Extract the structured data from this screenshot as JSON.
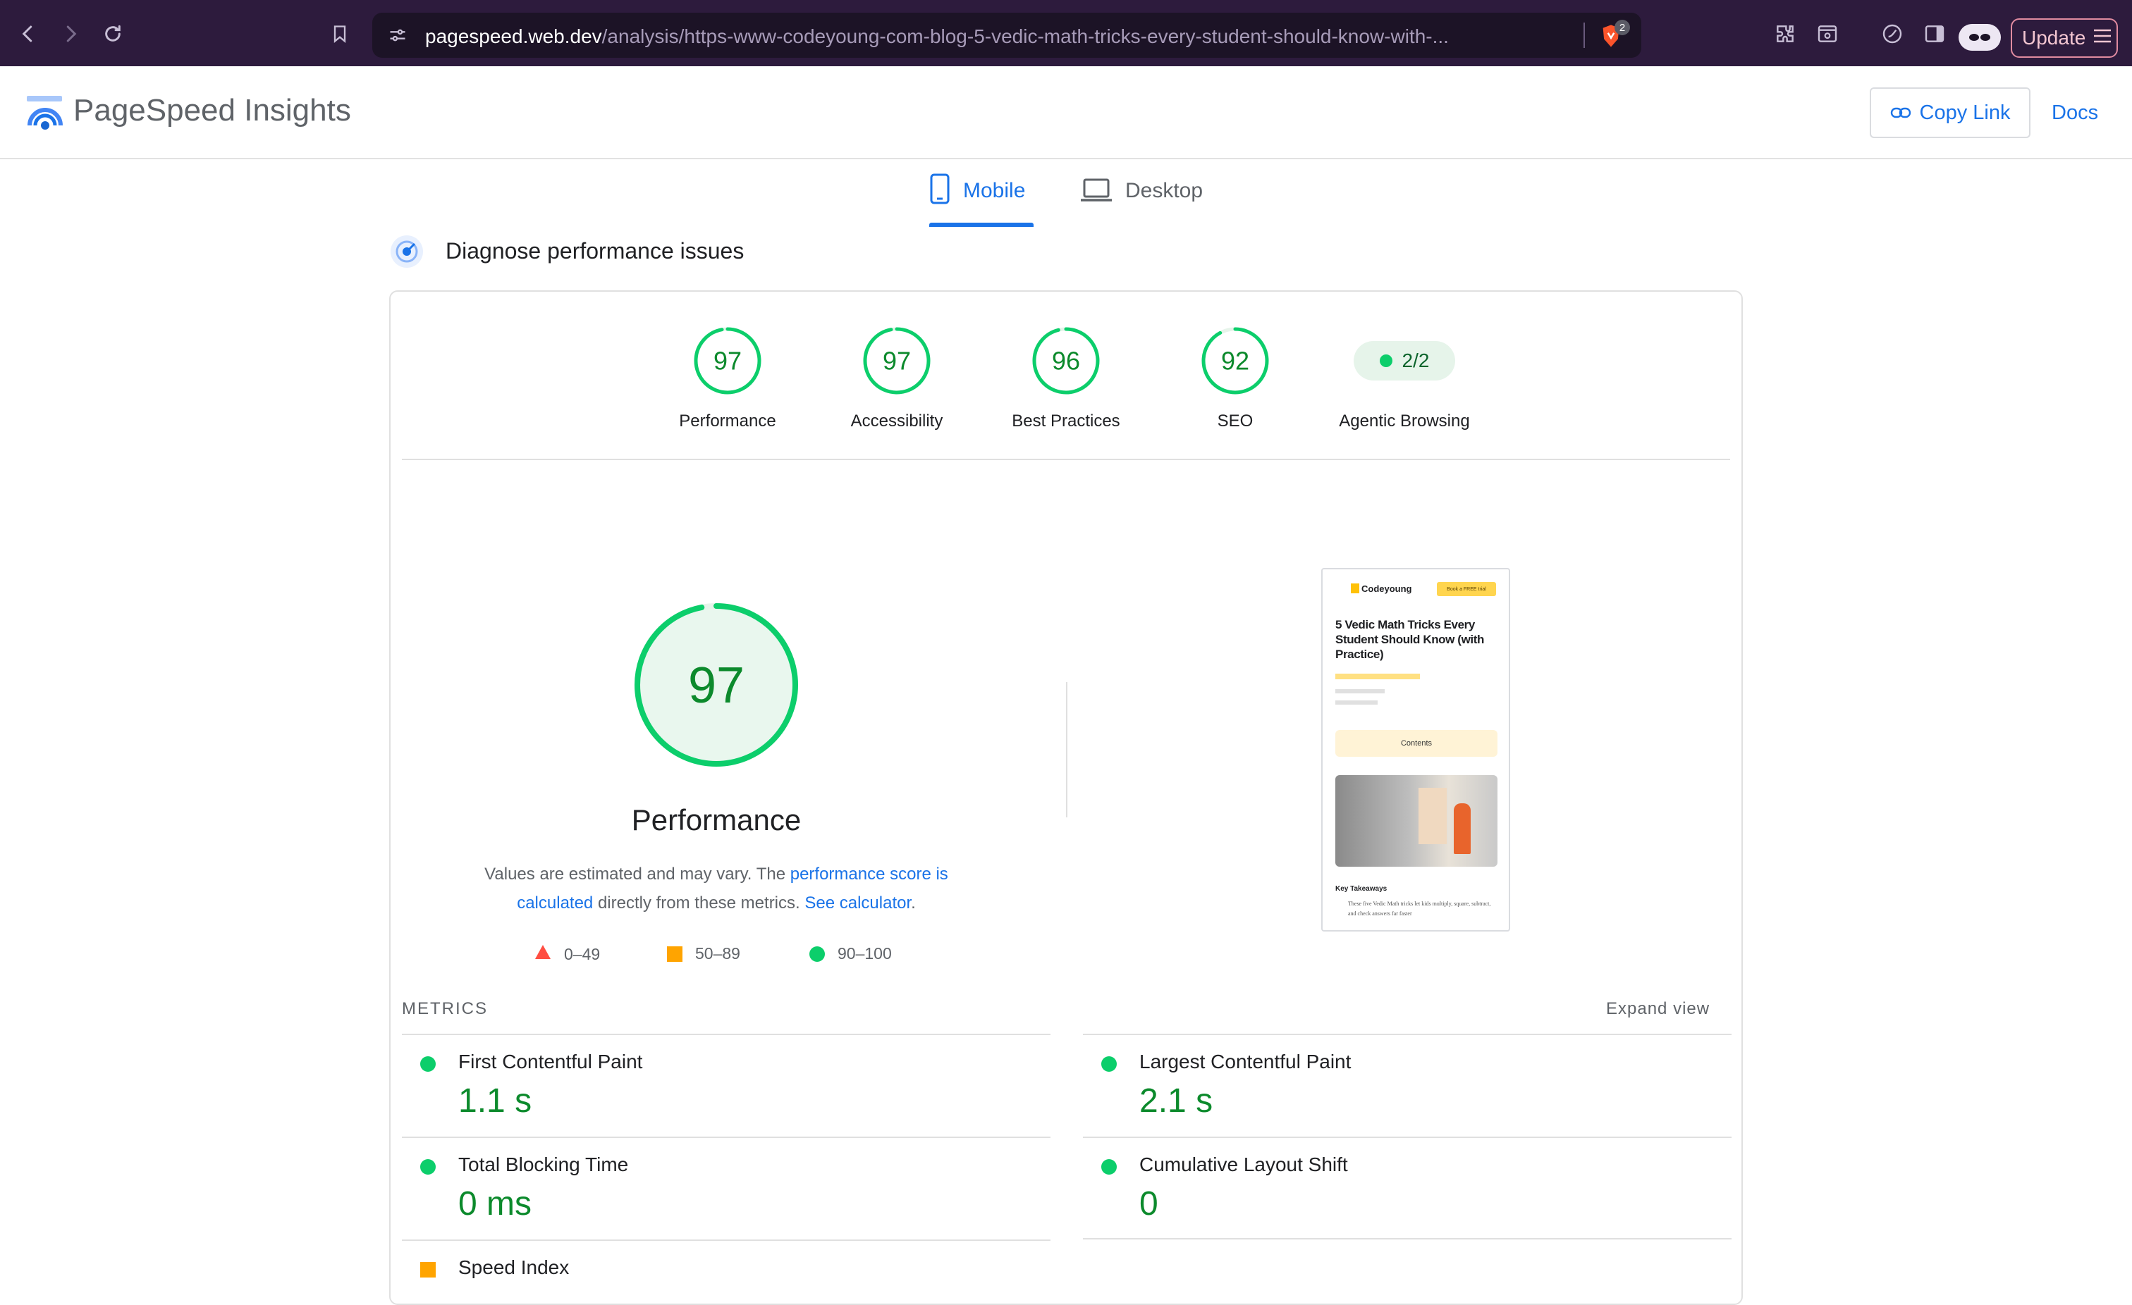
{
  "browser": {
    "url_host": "pagespeed.web.dev",
    "url_path": "/analysis/https-www-codeyoung-com-blog-5-vedic-math-tricks-every-student-should-know-with-...",
    "shield_count": "2",
    "update_label": "Update"
  },
  "header": {
    "title": "PageSpeed Insights",
    "copy_link": "Copy Link",
    "docs": "Docs"
  },
  "tabs": {
    "mobile": "Mobile",
    "desktop": "Desktop",
    "active": "Mobile"
  },
  "diagnose_title": "Diagnose performance issues",
  "scores": [
    {
      "label": "Performance",
      "value": 97
    },
    {
      "label": "Accessibility",
      "value": 97
    },
    {
      "label": "Best Practices",
      "value": 96
    },
    {
      "label": "SEO",
      "value": 92
    }
  ],
  "agentic": {
    "label": "Agentic Browsing",
    "value": "2/2"
  },
  "performance": {
    "score": 97,
    "title": "Performance",
    "desc_1": "Values are estimated and may vary. The ",
    "link_1": "performance score is calculated",
    "desc_2": " directly from these metrics. ",
    "link_2": "See calculator",
    "desc_3": "."
  },
  "legend": {
    "fail": "0–49",
    "average": "50–89",
    "pass": "90–100"
  },
  "colors": {
    "pass": "#0cce6b",
    "average": "#ffa400",
    "fail": "#ff4e42",
    "link": "#1a73e8"
  },
  "metrics": {
    "label": "METRICS",
    "expand": "Expand view",
    "items": [
      {
        "name": "First Contentful Paint",
        "value": "1.1 s",
        "rating": "pass"
      },
      {
        "name": "Largest Contentful Paint",
        "value": "2.1 s",
        "rating": "pass"
      },
      {
        "name": "Total Blocking Time",
        "value": "0 ms",
        "rating": "pass"
      },
      {
        "name": "Cumulative Layout Shift",
        "value": "0",
        "rating": "pass"
      },
      {
        "name": "Speed Index",
        "value": "",
        "rating": "average"
      }
    ]
  },
  "screenshot": {
    "brand": "Codeyoung",
    "cta": "Book a FREE trial",
    "headline": "5 Vedic Math Tricks Every Student Should Know (with Practice)",
    "contents": "Contents",
    "key_takeaways": "Key Takeaways",
    "takeaway_text": "These five Vedic Math tricks let kids multiply, square, subtract, and check answers far faster"
  }
}
